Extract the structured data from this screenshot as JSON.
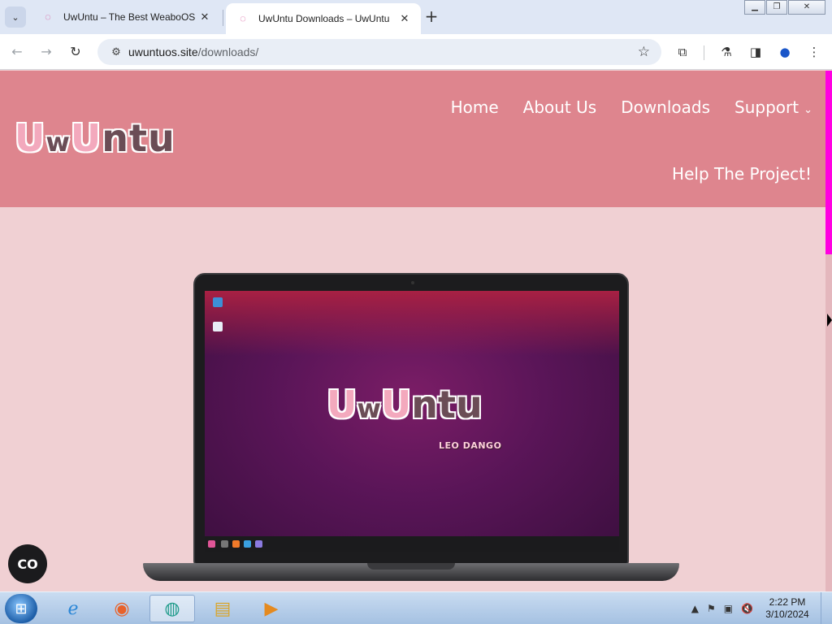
{
  "browser": {
    "tabs": [
      {
        "title": "UwUntu – The Best WeaboOS",
        "active": false
      },
      {
        "title": "UwUntu Downloads – UwUntu",
        "active": true
      }
    ],
    "url_host": "uwuntuos.site",
    "url_path": "/downloads/",
    "icons": {
      "tab_search": "chevron-down-icon",
      "back": "back-arrow-icon",
      "forward": "forward-arrow-icon",
      "reload": "reload-icon",
      "site_info": "tune-icon",
      "bookmark": "star-icon",
      "extensions": "puzzle-icon",
      "labs": "flask-icon",
      "side_panel": "side-panel-icon",
      "profile": "profile-icon",
      "menu": "kebab-icon"
    }
  },
  "site": {
    "logo": {
      "u1": "U",
      "w": "w",
      "u2": "U",
      "rest": "ntu"
    },
    "nav": {
      "home": "Home",
      "about": "About Us",
      "downloads": "Downloads",
      "support": "Support",
      "help": "Help The Project!"
    },
    "screen_logo": {
      "u1": "U",
      "w": "w",
      "u2": "U",
      "rest": "ntu",
      "subtitle": "LEO DANGO"
    },
    "colors": {
      "header": "#de858e",
      "page_bg": "#f0d0d3",
      "scroll_thumb": "#ff00e1"
    }
  },
  "chat_widget": {
    "label": "CO"
  },
  "taskbar": {
    "apps": [
      "internet-explorer-icon",
      "firefox-icon",
      "chrome-beta-icon",
      "file-explorer-icon",
      "media-player-icon"
    ],
    "time": "2:22 PM",
    "date": "3/10/2024"
  }
}
